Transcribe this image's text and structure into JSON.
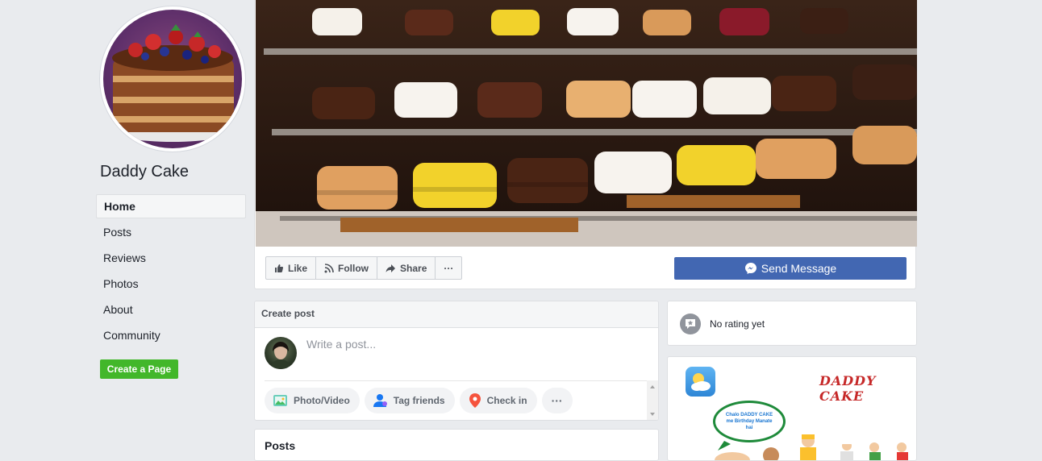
{
  "page": {
    "name": "Daddy Cake"
  },
  "sidebar": {
    "items": [
      {
        "label": "Home",
        "active": true
      },
      {
        "label": "Posts"
      },
      {
        "label": "Reviews"
      },
      {
        "label": "Photos"
      },
      {
        "label": "About"
      },
      {
        "label": "Community"
      }
    ],
    "create_page_label": "Create a Page"
  },
  "actions": {
    "like": "Like",
    "follow": "Follow",
    "share": "Share",
    "more": "···",
    "send_message": "Send Message"
  },
  "create_post": {
    "header": "Create post",
    "placeholder": "Write a post...",
    "buttons": {
      "photo_video": "Photo/Video",
      "tag_friends": "Tag friends",
      "check_in": "Check in",
      "more": "···"
    }
  },
  "posts": {
    "title": "Posts"
  },
  "rating": {
    "text": "No rating yet"
  },
  "ad": {
    "brand": "DADDY CAKE",
    "bubble_lines": [
      "Chalo DADDY CAKE",
      "me Birthday Manate",
      "hai"
    ]
  },
  "colors": {
    "background": "#e9ebee",
    "accent": "#4267b2",
    "create_page_green": "#42b72a"
  },
  "icons": {
    "like": "thumbs-up-icon",
    "follow": "rss-icon",
    "share": "share-arrow-icon",
    "messenger": "messenger-icon",
    "photo": "photo-icon",
    "tag": "tag-friends-icon",
    "checkin": "location-pin-icon",
    "rating": "star-bubble-icon"
  }
}
